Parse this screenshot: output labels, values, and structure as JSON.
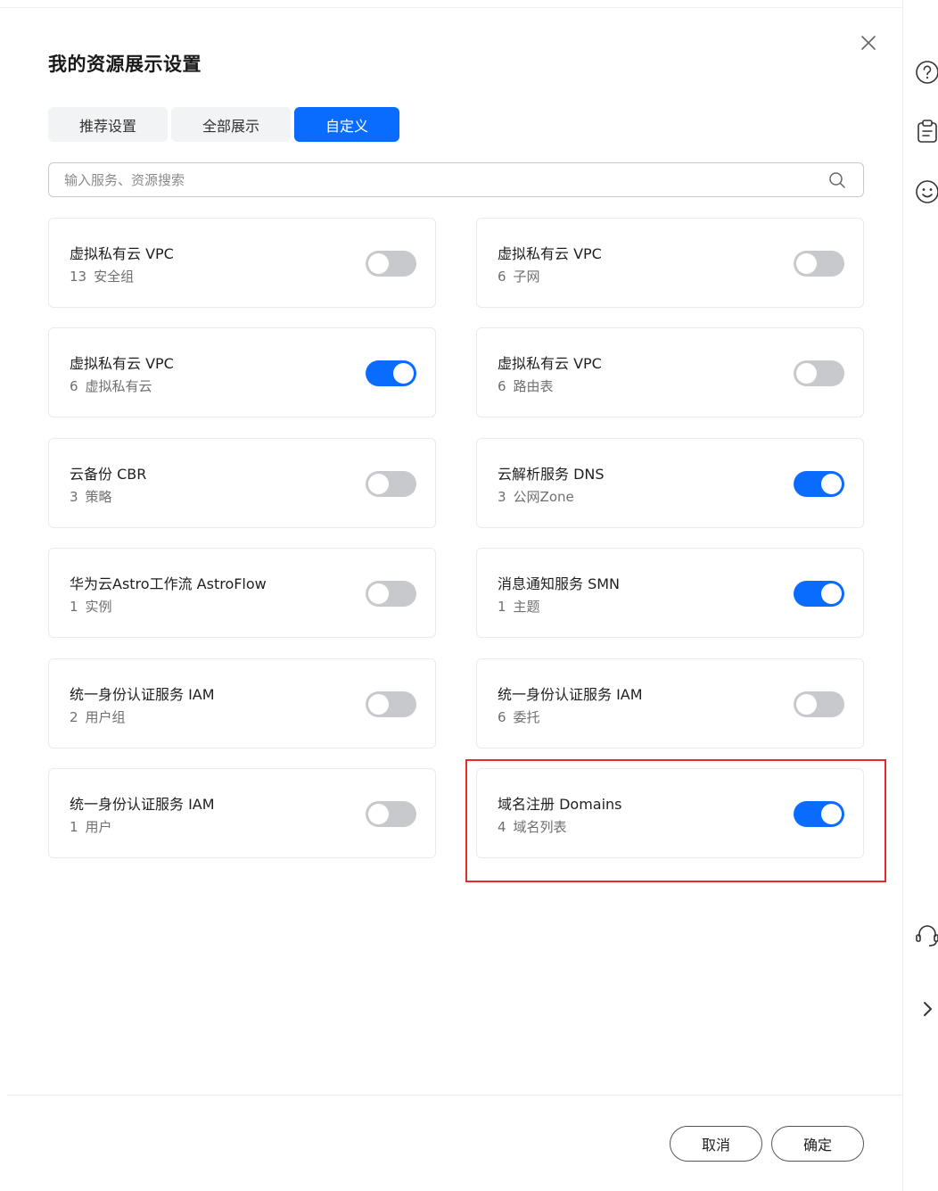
{
  "dialog": {
    "title": "我的资源展示设置",
    "tabs": [
      {
        "label": "推荐设置",
        "active": false
      },
      {
        "label": "全部展示",
        "active": false
      },
      {
        "label": "自定义",
        "active": true
      }
    ],
    "search": {
      "placeholder": "输入服务、资源搜索",
      "value": ""
    },
    "cards": [
      {
        "service": "虚拟私有云 VPC",
        "count": "13",
        "resource": "安全组",
        "enabled": false
      },
      {
        "service": "虚拟私有云 VPC",
        "count": "6",
        "resource": "子网",
        "enabled": false
      },
      {
        "service": "虚拟私有云 VPC",
        "count": "6",
        "resource": "虚拟私有云",
        "enabled": true
      },
      {
        "service": "虚拟私有云 VPC",
        "count": "6",
        "resource": "路由表",
        "enabled": false
      },
      {
        "service": "云备份 CBR",
        "count": "3",
        "resource": "策略",
        "enabled": false
      },
      {
        "service": "云解析服务 DNS",
        "count": "3",
        "resource": "公网Zone",
        "enabled": true
      },
      {
        "service": "华为云Astro工作流 AstroFlow",
        "count": "1",
        "resource": "实例",
        "enabled": false
      },
      {
        "service": "消息通知服务 SMN",
        "count": "1",
        "resource": "主题",
        "enabled": true
      },
      {
        "service": "统一身份认证服务 IAM",
        "count": "2",
        "resource": "用户组",
        "enabled": false
      },
      {
        "service": "统一身份认证服务 IAM",
        "count": "6",
        "resource": "委托",
        "enabled": false
      },
      {
        "service": "统一身份认证服务 IAM",
        "count": "1",
        "resource": "用户",
        "enabled": false
      },
      {
        "service": "域名注册 Domains",
        "count": "4",
        "resource": "域名列表",
        "enabled": true
      }
    ],
    "footer": {
      "cancel_label": "取消",
      "confirm_label": "确定"
    }
  },
  "colors": {
    "primary": "#0a6cff",
    "toggle_off": "#c8c9cc",
    "highlight": "#e52b2b"
  }
}
